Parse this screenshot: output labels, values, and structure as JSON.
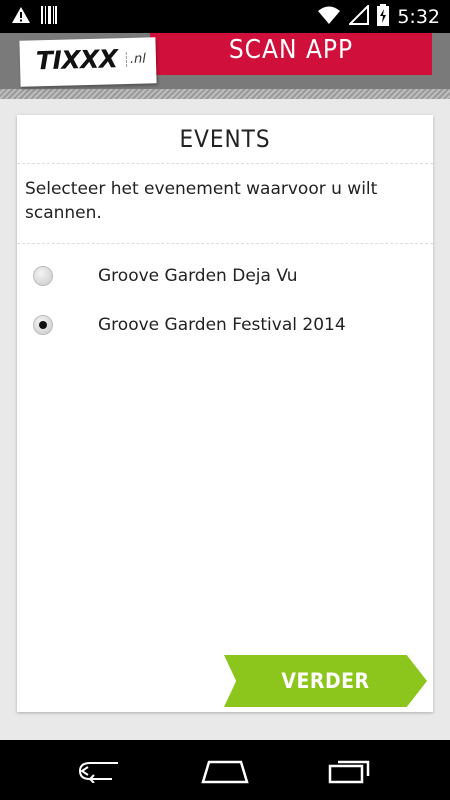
{
  "status_bar": {
    "time": "5:32",
    "left_icons": [
      "warning-icon",
      "barcode-icon"
    ],
    "right_icons": [
      "wifi-icon",
      "signal-icon",
      "battery-charging-icon"
    ]
  },
  "header": {
    "logo_brand": "TIXXX",
    "logo_tld": ".nl",
    "app_title": "SCAN APP",
    "colors": {
      "banner": "#d0103a",
      "header_bg": "#7a7a7a"
    }
  },
  "card": {
    "title": "EVENTS",
    "intro": "Selecteer het evenement waarvoor u wilt scannen.",
    "options": [
      {
        "label": "Groove Garden Deja Vu",
        "selected": false
      },
      {
        "label": "Groove Garden Festival 2014",
        "selected": true
      }
    ],
    "next_button": "VERDER",
    "colors": {
      "next_button": "#8cc51b"
    }
  },
  "nav_bar": {
    "buttons": [
      "back-icon",
      "home-icon",
      "recent-apps-icon"
    ]
  }
}
